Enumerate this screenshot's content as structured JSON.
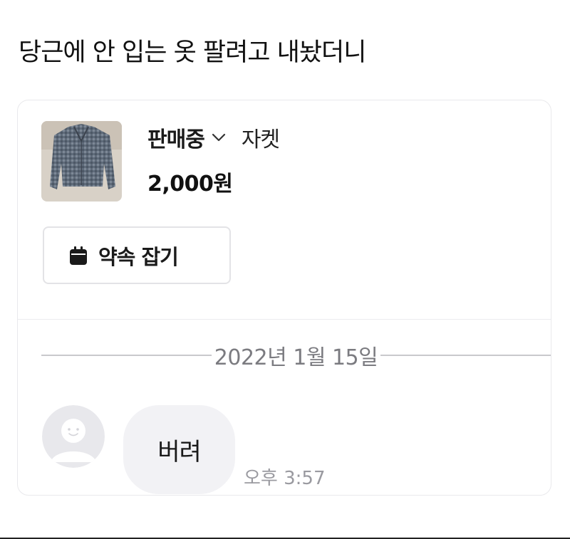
{
  "post": {
    "title": "당근에 안 입는 옷 팔려고 내놨더니"
  },
  "product": {
    "status": "판매중",
    "item_name": "자켓",
    "price": "2,000원",
    "thumbnail_icon": "jacket-photo"
  },
  "actions": {
    "appointment_label": "약속 잡기",
    "appointment_icon": "calendar-icon"
  },
  "chat": {
    "date": "2022년 1월 15일",
    "messages": [
      {
        "text": "버려",
        "time": "오후 3:57"
      }
    ]
  },
  "colors": {
    "border": "#e9e9ec",
    "bubble_bg": "#f2f2f5",
    "muted_text": "#7b7b80"
  }
}
